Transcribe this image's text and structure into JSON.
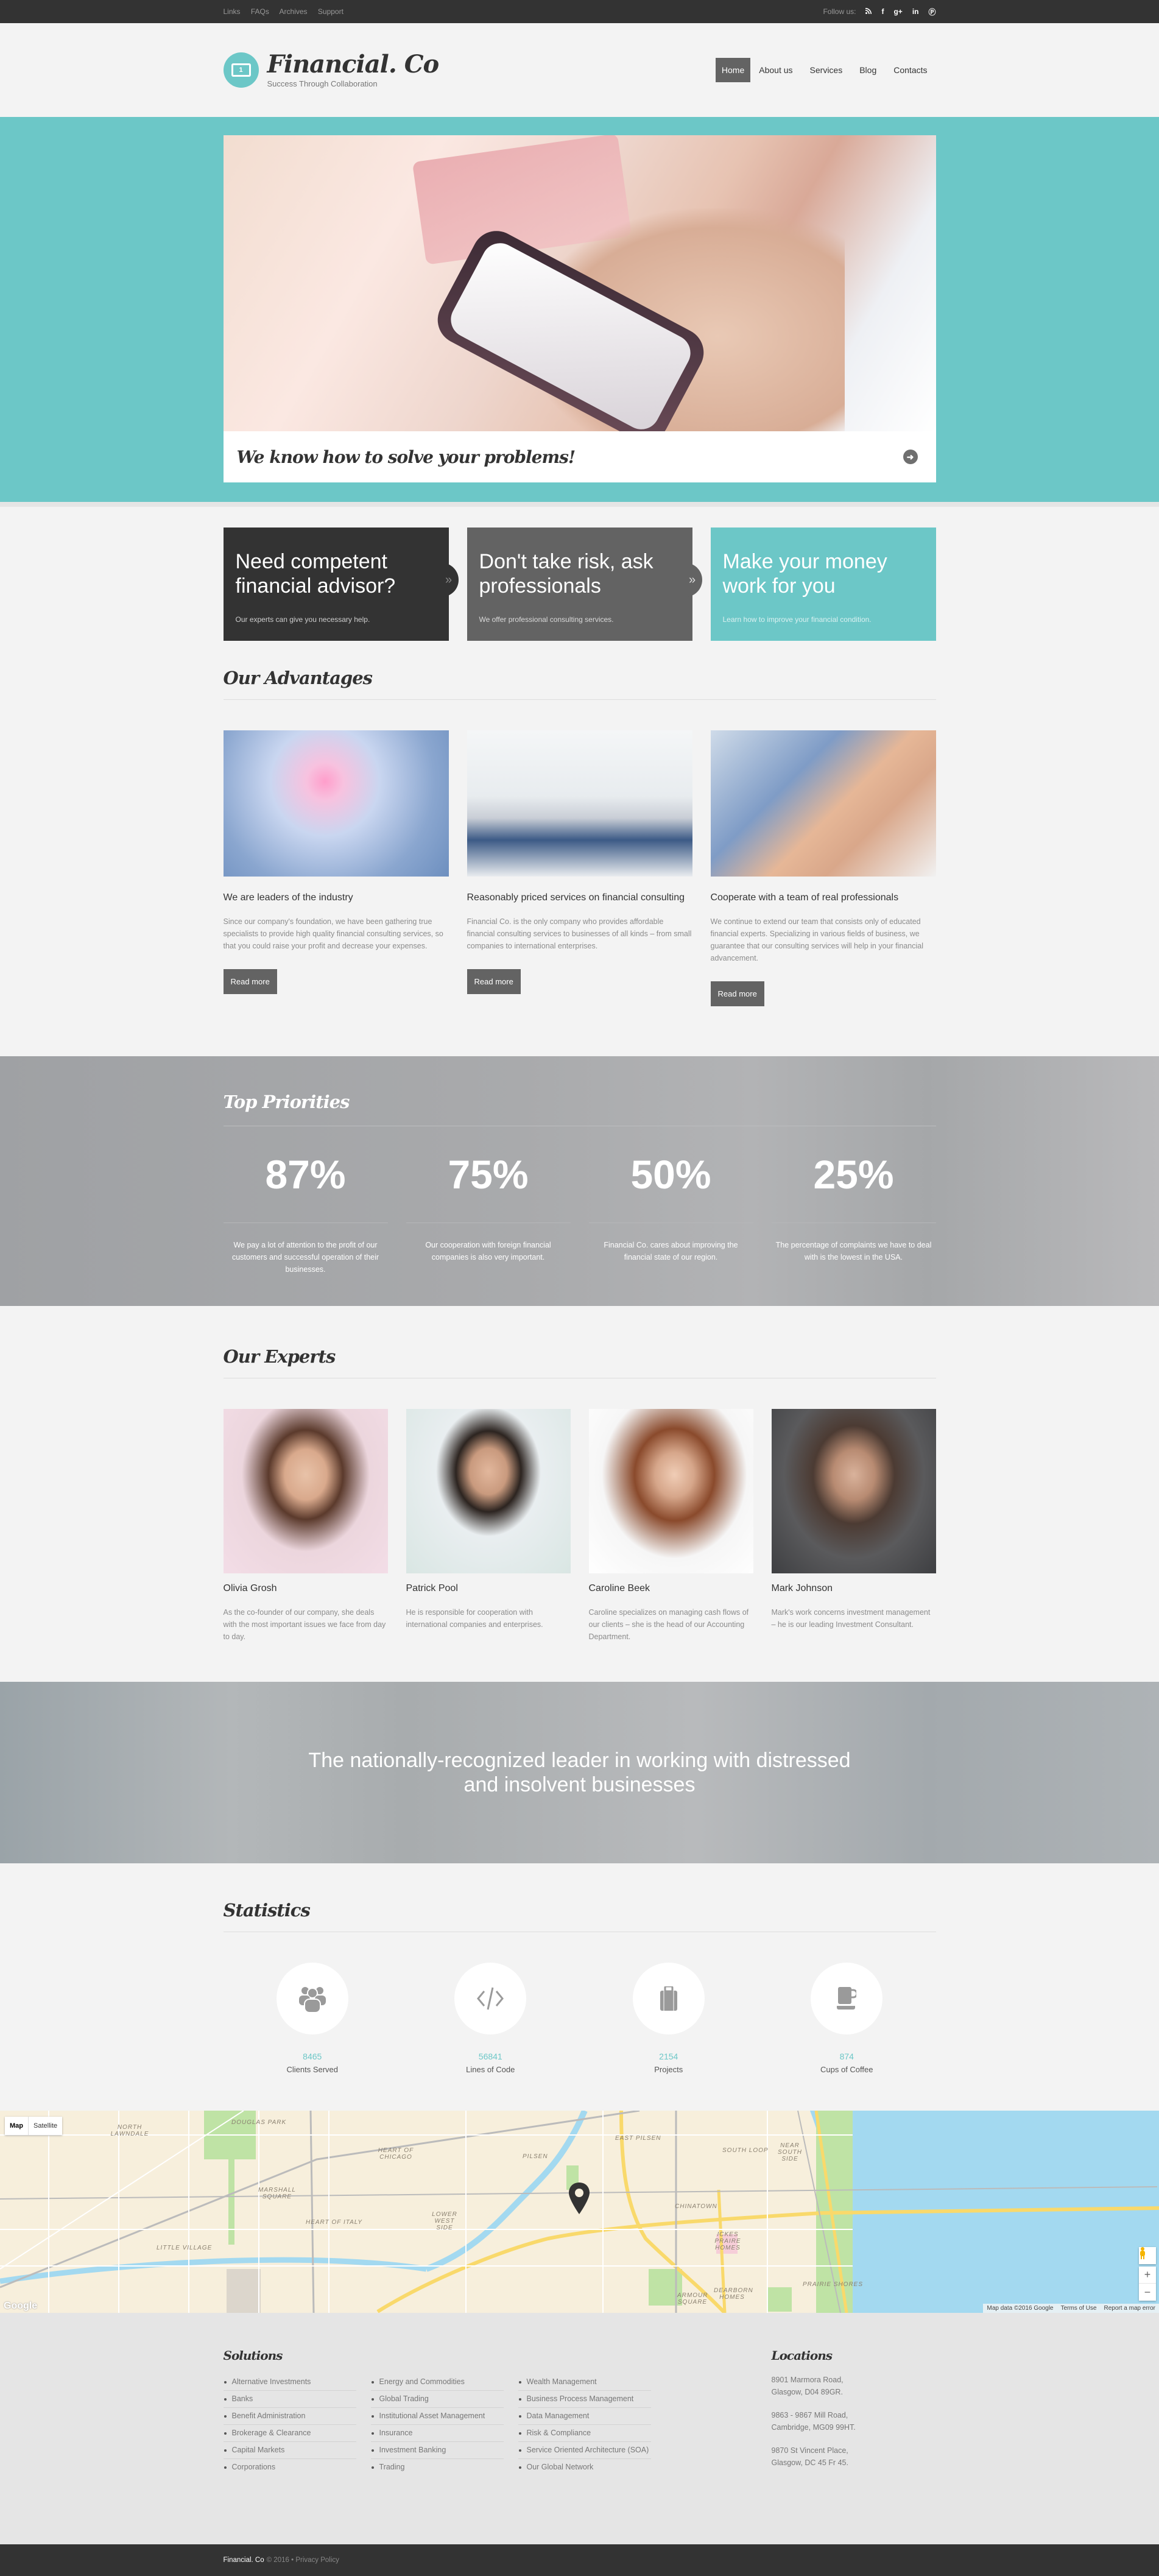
{
  "topbar": {
    "links": [
      "Links",
      "FAQs",
      "Archives",
      "Support"
    ],
    "follow_label": "Follow us:",
    "social_icons": [
      "rss-icon",
      "facebook-icon",
      "google-plus-icon",
      "linkedin-icon",
      "pinterest-icon"
    ],
    "social_glyphs": [
      "ॐ",
      "f",
      "g+",
      "in",
      "Ⓟ"
    ]
  },
  "header": {
    "brand": "Financial. Co",
    "tagline": "Success Through Collaboration",
    "logo_glyph": "1",
    "nav": [
      {
        "label": "Home",
        "active": true
      },
      {
        "label": "About us"
      },
      {
        "label": "Services"
      },
      {
        "label": "Blog"
      },
      {
        "label": "Contacts"
      }
    ]
  },
  "hero": {
    "caption": "We know how to solve your problems!",
    "arrow_glyph": "➜"
  },
  "promos": [
    {
      "title": "Need competent financial advisor?",
      "text": "Our experts can give you necessary help.",
      "chevron": "»"
    },
    {
      "title": "Don't take risk, ask professionals",
      "text": "We offer professional consulting services.",
      "chevron": "»"
    },
    {
      "title": "Make your money work for you",
      "text": "Learn how to improve your financial condition."
    }
  ],
  "advantages": {
    "title": "Our Advantages",
    "items": [
      {
        "heading": "We are leaders of the industry",
        "text": "Since our company's foundation, we have been gathering true specialists to provide high quality financial consulting services, so that you could raise your profit and decrease your expenses.",
        "button": "Read more"
      },
      {
        "heading": "Reasonably priced services on financial consulting",
        "text": "Financial Co. is the only company who provides affordable financial consulting services to businesses of all kinds – from small companies to international enterprises.",
        "button": "Read more"
      },
      {
        "heading": "Cooperate with a team of real professionals",
        "text": "We continue to extend our team that consists only of educated financial experts. Specializing in various fields of business, we guarantee that our consulting services will help in your financial advancement.",
        "button": "Read more"
      }
    ]
  },
  "priorities": {
    "title": "Top Priorities",
    "items": [
      {
        "value": "87%",
        "text": "We pay a lot of attention to the profit of our customers and successful operation of their businesses."
      },
      {
        "value": "75%",
        "text": "Our cooperation with foreign financial companies is also very important."
      },
      {
        "value": "50%",
        "text": "Financial Co. cares about improving the financial state of our region."
      },
      {
        "value": "25%",
        "text": "The percentage of complaints we have to deal with is the lowest in the USA."
      }
    ]
  },
  "experts": {
    "title": "Our Experts",
    "items": [
      {
        "name": "Olivia Grosh",
        "text": "As the co-founder of our company, she deals with the most important issues we face from day to day."
      },
      {
        "name": "Patrick Pool",
        "text": "He is responsible for cooperation with international companies and enterprises."
      },
      {
        "name": "Caroline Beek",
        "text": "Caroline specializes on managing cash flows of our clients – she is the head of our Accounting Department."
      },
      {
        "name": "Mark Johnson",
        "text": "Mark's work concerns investment management – he is our leading Investment Consultant."
      }
    ]
  },
  "banner": {
    "text": "The nationally-recognized leader in working with distressed and insolvent businesses"
  },
  "statistics": {
    "title": "Statistics",
    "items": [
      {
        "icon": "users-icon",
        "glyph": "👥",
        "value": "8465",
        "label": "Clients Served"
      },
      {
        "icon": "code-icon",
        "glyph": "</>",
        "value": "56841",
        "label": "Lines of Code"
      },
      {
        "icon": "briefcase-icon",
        "glyph": "💼",
        "value": "2154",
        "label": "Projects"
      },
      {
        "icon": "coffee-icon",
        "glyph": "☕",
        "value": "874",
        "label": "Cups of Coffee"
      }
    ]
  },
  "map": {
    "toggle": [
      "Map",
      "Satellite"
    ],
    "labels": [
      "DOUGLAS PARK",
      "NORTH LAWNDALE",
      "HEART OF CHICAGO",
      "MARSHALL SQUARE",
      "HEART OF ITALY",
      "LITTLE VILLAGE",
      "PILSEN",
      "EAST PILSEN",
      "LOWER WEST SIDE",
      "CHINATOWN",
      "SOUTH LOOP",
      "NEAR SOUTH SIDE",
      "ICKES PRAIRE HOMES",
      "DEARBORN HOMES",
      "ARMOUR SQUARE",
      "PRAIRIE SHORES"
    ],
    "attribution": [
      "Map data ©2016 Google",
      "Terms of Use",
      "Report a map error"
    ],
    "google": "Google",
    "zoom_in": "+",
    "zoom_out": "−"
  },
  "footer": {
    "solutions_title": "Solutions",
    "columns": [
      [
        "Alternative Investments",
        "Banks",
        "Benefit Administration",
        "Brokerage & Clearance",
        "Capital Markets",
        "Corporations"
      ],
      [
        "Energy and Commodities",
        "Global Trading",
        "Institutional Asset Management",
        "Insurance",
        "Investment Banking",
        "Trading"
      ],
      [
        "Wealth Management",
        "Business Process Management",
        "Data Management",
        "Risk & Compliance",
        "Service Oriented Architecture (SOA)",
        "Our Global Network"
      ]
    ],
    "locations_title": "Locations",
    "locations": [
      [
        "8901 Marmora Road,",
        "Glasgow, D04 89GR."
      ],
      [
        "9863 - 9867 Mill Road,",
        "Cambridge, MG09 99HT."
      ],
      [
        "9870 St Vincent Place,",
        "Glasgow, DC 45 Fr 45."
      ]
    ]
  },
  "bottombar": {
    "brand": "Financial. Co",
    "copyright": "© 2016 •",
    "privacy": "Privacy Policy"
  }
}
